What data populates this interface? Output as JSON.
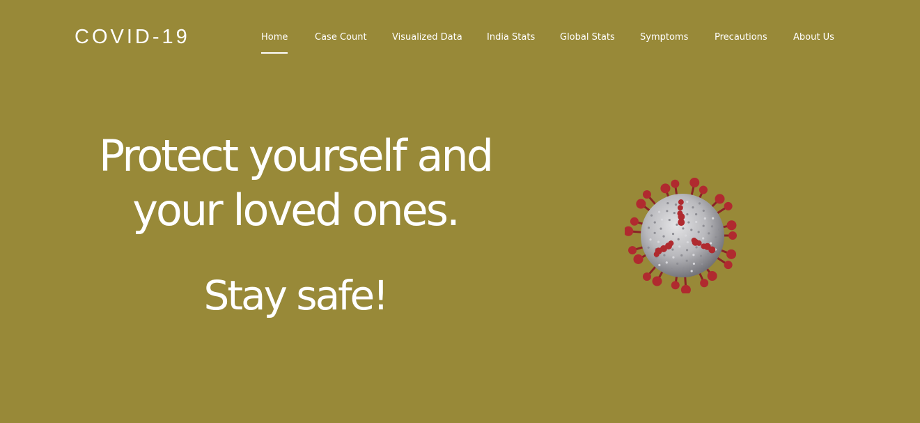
{
  "brand": {
    "title": "COVID-19"
  },
  "nav": {
    "items": [
      {
        "label": "Home",
        "active": true
      },
      {
        "label": "Case Count"
      },
      {
        "label": "Visualized Data"
      },
      {
        "label": "India Stats"
      },
      {
        "label": "Global Stats"
      },
      {
        "label": "Symptoms"
      },
      {
        "label": "Precautions"
      },
      {
        "label": "About Us"
      }
    ]
  },
  "hero": {
    "headline_line1": "Protect yourself and",
    "headline_line2": "your loved ones.",
    "tagline": "Stay safe!",
    "image_icon": "coronavirus-icon"
  },
  "colors": {
    "background": "#988938",
    "text": "#ffffff",
    "virus_spike": "#b02a2f",
    "virus_body": "#b9b9bd"
  }
}
